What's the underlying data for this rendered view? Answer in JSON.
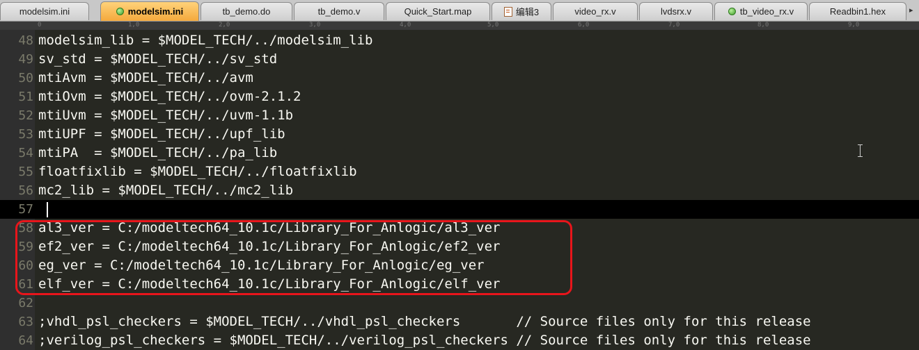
{
  "tabs": [
    {
      "label": "modelsim.ini",
      "active": false,
      "icon": ""
    },
    {
      "label": "modelsim.ini",
      "active": true,
      "icon": "green-dot"
    },
    {
      "label": "tb_demo.do",
      "active": false,
      "icon": ""
    },
    {
      "label": "tb_demo.v",
      "active": false,
      "icon": ""
    },
    {
      "label": "Quick_Start.map",
      "active": false,
      "icon": ""
    },
    {
      "label": "编辑3",
      "active": false,
      "icon": "document"
    },
    {
      "label": "video_rx.v",
      "active": false,
      "icon": ""
    },
    {
      "label": "lvdsrx.v",
      "active": false,
      "icon": ""
    },
    {
      "label": "tb_video_rx.v",
      "active": false,
      "icon": "green-dot"
    },
    {
      "label": "Readbin1.hex",
      "active": false,
      "icon": ""
    }
  ],
  "ruler": [
    "0",
    "1,0",
    "2,0",
    "3,0",
    "4,0",
    "5,0",
    "6,0",
    "7,0",
    "8,0",
    "9,0"
  ],
  "lines": [
    {
      "num": "48",
      "text": "modelsim_lib = $MODEL_TECH/../modelsim_lib"
    },
    {
      "num": "49",
      "text": "sv_std = $MODEL_TECH/../sv_std"
    },
    {
      "num": "50",
      "text": "mtiAvm = $MODEL_TECH/../avm"
    },
    {
      "num": "51",
      "text": "mtiOvm = $MODEL_TECH/../ovm-2.1.2"
    },
    {
      "num": "52",
      "text": "mtiUvm = $MODEL_TECH/../uvm-1.1b"
    },
    {
      "num": "53",
      "text": "mtiUPF = $MODEL_TECH/../upf_lib"
    },
    {
      "num": "54",
      "text": "mtiPA  = $MODEL_TECH/../pa_lib"
    },
    {
      "num": "55",
      "text": "floatfixlib = $MODEL_TECH/../floatfixlib"
    },
    {
      "num": "56",
      "text": "mc2_lib = $MODEL_TECH/../mc2_lib"
    },
    {
      "num": "57",
      "text": ""
    },
    {
      "num": "58",
      "text": "al3_ver = C:/modeltech64_10.1c/Library_For_Anlogic/al3_ver"
    },
    {
      "num": "59",
      "text": "ef2_ver = C:/modeltech64_10.1c/Library_For_Anlogic/ef2_ver"
    },
    {
      "num": "60",
      "text": "eg_ver = C:/modeltech64_10.1c/Library_For_Anlogic/eg_ver"
    },
    {
      "num": "61",
      "text": "elf_ver = C:/modeltech64_10.1c/Library_For_Anlogic/elf_ver"
    },
    {
      "num": "62",
      "text": ""
    },
    {
      "num": "63",
      "text": ";vhdl_psl_checkers = $MODEL_TECH/../vhdl_psl_checkers       // Source files only for this release"
    },
    {
      "num": "64",
      "text": ";verilog_psl_checkers = $MODEL_TECH/../verilog_psl_checkers // Source files only for this release"
    }
  ],
  "colors": {
    "editor_bg": "#272822",
    "highlight_border": "#e8151b",
    "active_tab": "#f4a93c"
  }
}
